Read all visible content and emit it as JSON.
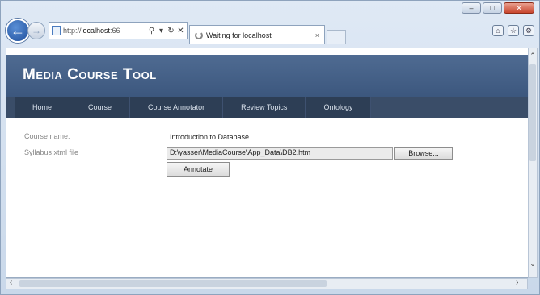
{
  "browser": {
    "address_prefix": "http://",
    "address_host": "localhost",
    "address_suffix": ":66",
    "search_icon": "magnifier-icon",
    "refresh_label": "↻",
    "stop_label": "✕",
    "tab_title": "Waiting for localhost",
    "tab_close": "×",
    "window_buttons": {
      "minimize": "–",
      "maximize": "□",
      "close": "✕"
    },
    "tools": {
      "home": "⌂",
      "favorites": "☆",
      "settings": "⚙"
    }
  },
  "site": {
    "title": "Media Course Tool",
    "accent_color": "#46618a"
  },
  "menu": {
    "items": [
      {
        "label": "Home"
      },
      {
        "label": "Course"
      },
      {
        "label": "Course Annotator"
      },
      {
        "label": "Review Topics"
      },
      {
        "label": "Ontology"
      }
    ]
  },
  "form": {
    "course_label": "Course name:",
    "course_value": "Introduction to Database",
    "syllabus_label": "Syllabus xtml file",
    "syllabus_value": "D:\\yasser\\MediaCourse\\App_Data\\DB2.htm",
    "browse_label": "Browse...",
    "annotate_label": "Annotate"
  }
}
